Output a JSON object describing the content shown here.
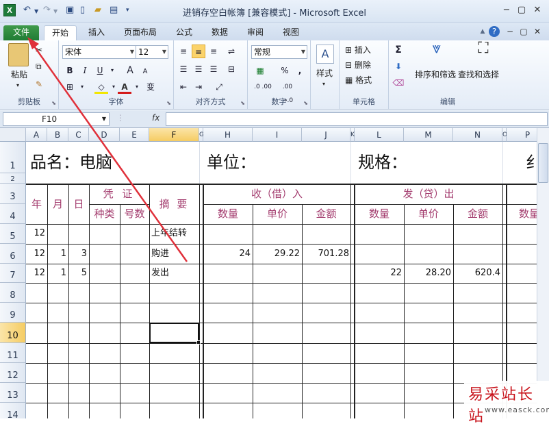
{
  "window": {
    "title": "进销存空白帐簿  [兼容模式]  -  Microsoft Excel",
    "app_icon": "X",
    "minimize": "−",
    "restore": "▢",
    "close": "✕"
  },
  "tabs": [
    "文件",
    "开始",
    "插入",
    "页面布局",
    "公式",
    "数据",
    "审阅",
    "视图"
  ],
  "ribbon": {
    "clipboard": {
      "paste": "粘贴",
      "label": "剪贴板"
    },
    "font": {
      "name": "宋体",
      "size": "12",
      "bold": "B",
      "italic": "I",
      "underline": "U",
      "grow": "A",
      "shrink": "A",
      "label": "字体",
      "phonetic": "变"
    },
    "alignment": {
      "label": "对齐方式"
    },
    "number": {
      "format": "常规",
      "percent": "%",
      "comma": ",",
      "label": "数字",
      "inc": ".0 .00",
      "dec": ".00 →.0"
    },
    "styles": {
      "label": "样式"
    },
    "cells": {
      "insert": "插入",
      "delete": "删除",
      "format": "格式",
      "label": "单元格"
    },
    "editing": {
      "sum": "Σ",
      "sort": "排序和筛选",
      "find": "查找和选择",
      "label": "编辑"
    }
  },
  "formula_bar": {
    "name_box": "F10",
    "fx": "fx",
    "value": ""
  },
  "columns": [
    "A",
    "B",
    "C",
    "D",
    "E",
    "F",
    "G",
    "H",
    "I",
    "J",
    "K",
    "L",
    "M",
    "N",
    "O",
    "P"
  ],
  "selected_column": "F",
  "rows": [
    "1",
    "2",
    "3",
    "4",
    "5",
    "6",
    "7",
    "8",
    "9",
    "10",
    "11",
    "12",
    "13",
    "14"
  ],
  "selected_row": "10",
  "sheet": {
    "product_label": "品名：电脑",
    "unit_label": "单位：",
    "spec_label": "规格：",
    "cut_label": "纟",
    "year": "年",
    "month": "月",
    "day": "日",
    "voucher": "凭 证",
    "voucher_type": "种类",
    "voucher_no": "号数",
    "summary": "摘 要",
    "receive": "收（借）入",
    "issue": "发（贷）出",
    "qty": "数量",
    "price": "单价",
    "amount": "金额",
    "qty_cut": "数量",
    "rows": [
      {
        "year": "12",
        "month": "",
        "day": "",
        "summary": "上年结转",
        "in_qty": "",
        "in_price": "",
        "in_amount": "",
        "out_qty": "",
        "out_price": "",
        "out_amount": ""
      },
      {
        "year": "12",
        "month": "1",
        "day": "3",
        "summary": "购进",
        "in_qty": "24",
        "in_price": "29.22",
        "in_amount": "701.28",
        "out_qty": "",
        "out_price": "",
        "out_amount": ""
      },
      {
        "year": "12",
        "month": "1",
        "day": "5",
        "summary": "发出",
        "in_qty": "",
        "in_price": "",
        "in_amount": "",
        "out_qty": "22",
        "out_price": "28.20",
        "out_amount": "620.4"
      }
    ]
  },
  "watermark": {
    "text": "易采站长站",
    "url": "www.easck.com"
  }
}
